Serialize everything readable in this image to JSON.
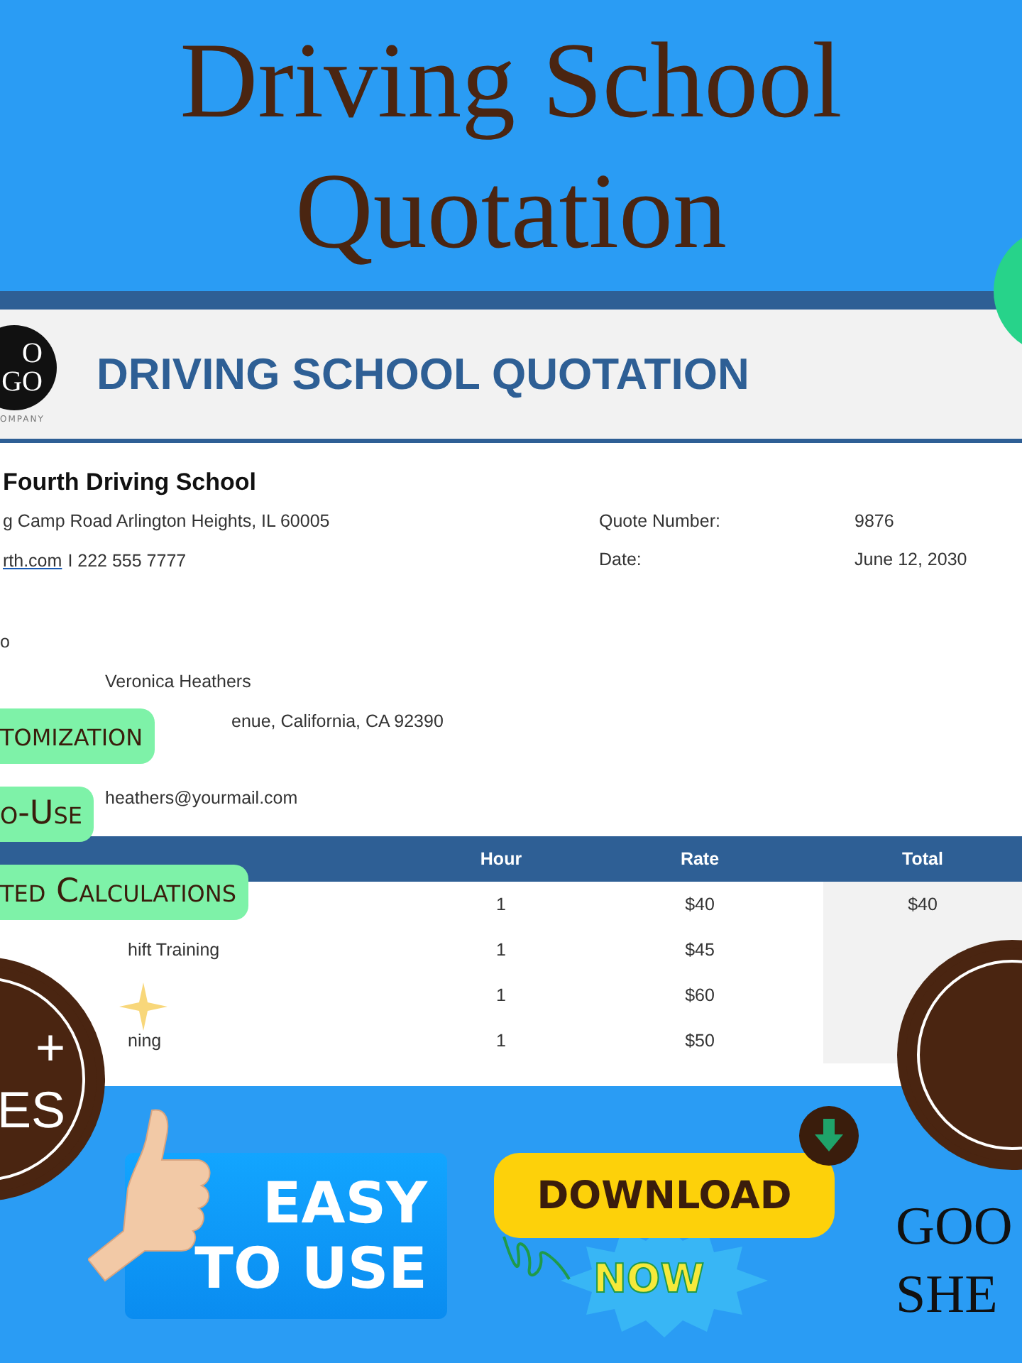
{
  "banner": {
    "title_lines": [
      "Driving School",
      "Quotation"
    ]
  },
  "document": {
    "logo": {
      "lines": [
        "O",
        "GO"
      ],
      "caption": "OMPANY"
    },
    "title": "DRIVING SCHOOL QUOTATION",
    "company": {
      "name": "Fourth Driving School",
      "address": "g Camp Road Arlington Heights, IL 60005",
      "website": "rth.com",
      "phone": "I 222 555 7777"
    },
    "meta": [
      {
        "label": "Quote Number:",
        "value": "9876"
      },
      {
        "label": "Date:",
        "value": "June 12, 2030"
      }
    ],
    "recipient": {
      "heading": "o",
      "lines": [
        "Veronica Heathers",
        "enue, California, CA 92390",
        "heathers@yourmail.com"
      ]
    },
    "table": {
      "columns": [
        "Hour",
        "Rate",
        "Total"
      ],
      "rows": [
        {
          "hour": "1",
          "rate": "$40",
          "total": "$40"
        },
        {
          "description": "hift Training",
          "hour": "1",
          "rate": "$45"
        },
        {
          "hour": "1",
          "rate": "$60"
        },
        {
          "description": "ning",
          "hour": "1",
          "rate": "$50"
        }
      ]
    }
  },
  "features": [
    "tomization",
    "o-Use",
    "ted Calculations"
  ],
  "seal": {
    "lines": [
      "+",
      "ES"
    ]
  },
  "easy": {
    "lines": [
      "EASY",
      "TO USE"
    ]
  },
  "download": {
    "label": "DOWNLOAD",
    "burst": "NOW"
  },
  "sheets": {
    "lines": [
      "GOO",
      "SHE"
    ]
  }
}
